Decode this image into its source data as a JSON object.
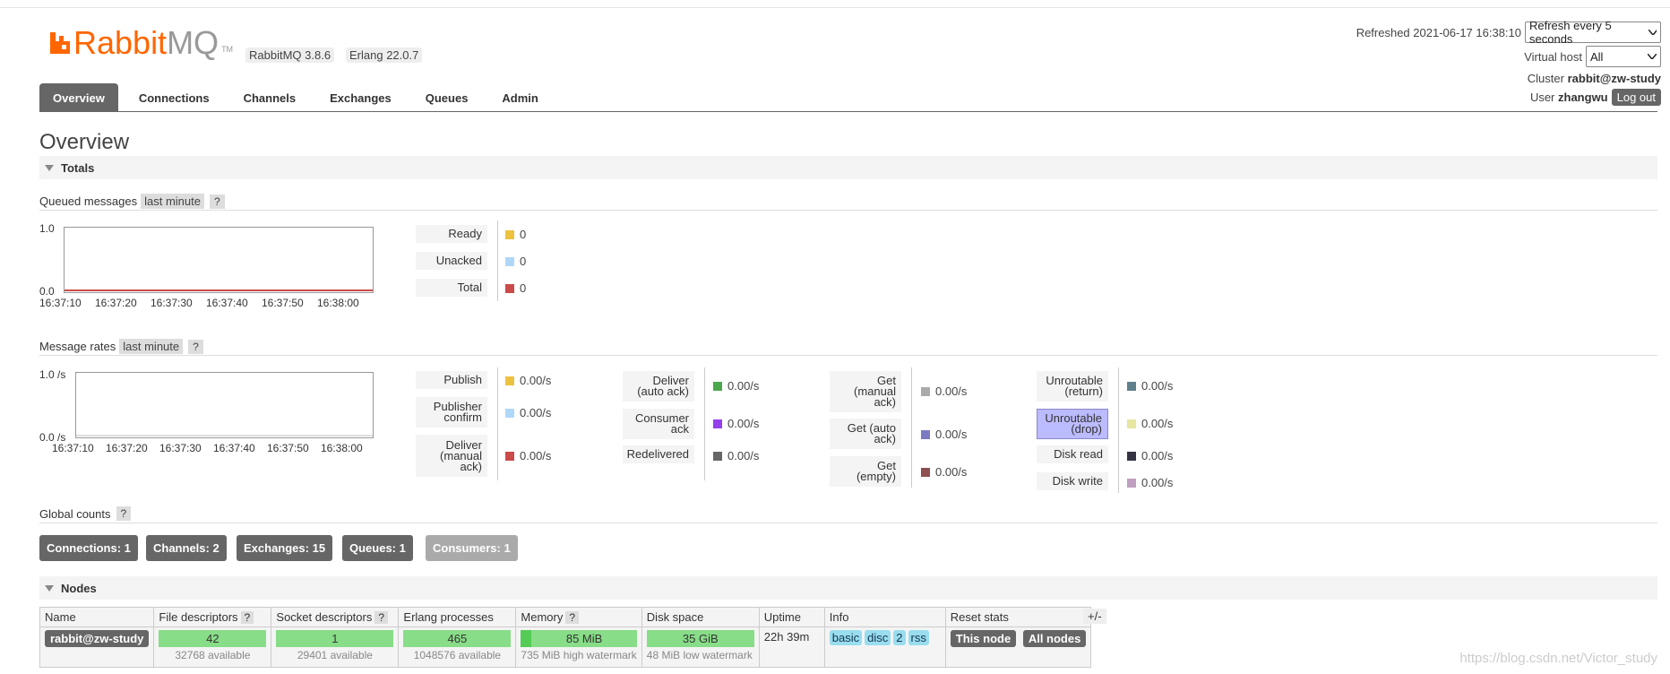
{
  "brand": {
    "rabbit": "Rabbit",
    "mq": "MQ",
    "tm": "TM"
  },
  "versions": {
    "rabbitmq": "RabbitMQ 3.8.6",
    "erlang": "Erlang 22.0.7"
  },
  "header": {
    "refreshed": "Refreshed 2021-06-17 16:38:10",
    "refresh_select": "Refresh every 5 seconds",
    "vhost_label": "Virtual host",
    "vhost_value": "All",
    "cluster_label": "Cluster",
    "cluster_value": "rabbit@zw-study",
    "user_label": "User",
    "user_value": "zhangwu",
    "logout": "Log out"
  },
  "tabs": [
    "Overview",
    "Connections",
    "Channels",
    "Exchanges",
    "Queues",
    "Admin"
  ],
  "page_title": "Overview",
  "totals": {
    "header": "Totals",
    "queued": {
      "label": "Queued messages",
      "range": "last minute",
      "help": "?",
      "y_top": "1.0",
      "y_bottom": "0.0",
      "x_ticks": [
        "16:37:10",
        "16:37:20",
        "16:37:30",
        "16:37:40",
        "16:37:50",
        "16:38:00"
      ],
      "legend": [
        {
          "label": "Ready",
          "value": "0",
          "color": "#edc240"
        },
        {
          "label": "Unacked",
          "value": "0",
          "color": "#afd8f8"
        },
        {
          "label": "Total",
          "value": "0",
          "color": "#cb4b4b"
        }
      ]
    },
    "rates": {
      "label": "Message rates",
      "range": "last minute",
      "help": "?",
      "y_top": "1.0 /s",
      "y_bottom": "0.0 /s",
      "x_ticks": [
        "16:37:10",
        "16:37:20",
        "16:37:30",
        "16:37:40",
        "16:37:50",
        "16:38:00"
      ],
      "col1": [
        {
          "label": "Publish",
          "value": "0.00/s",
          "color": "#edc240"
        },
        {
          "label": "Publisher confirm",
          "value": "0.00/s",
          "color": "#afd8f8"
        },
        {
          "label": "Deliver (manual ack)",
          "value": "0.00/s",
          "color": "#cb4b4b"
        }
      ],
      "col2": [
        {
          "label": "Deliver (auto ack)",
          "value": "0.00/s",
          "color": "#4da74d"
        },
        {
          "label": "Consumer ack",
          "value": "0.00/s",
          "color": "#9440ed"
        },
        {
          "label": "Redelivered",
          "value": "0.00/s",
          "color": "#666666"
        }
      ],
      "col3": [
        {
          "label": "Get (manual ack)",
          "value": "0.00/s",
          "color": "#aaaaaa"
        },
        {
          "label": "Get (auto ack)",
          "value": "0.00/s",
          "color": "#7c79c3"
        },
        {
          "label": "Get (empty)",
          "value": "0.00/s",
          "color": "#8d4f51"
        }
      ],
      "col4": [
        {
          "label": "Unroutable (return)",
          "value": "0.00/s",
          "color": "#5f7f8c"
        },
        {
          "label": "Unroutable (drop)",
          "value": "0.00/s",
          "color": "#e6e6a0"
        },
        {
          "label": "Disk read",
          "value": "0.00/s",
          "color": "#333344"
        },
        {
          "label": "Disk write",
          "value": "0.00/s",
          "color": "#bf9fbf"
        }
      ]
    }
  },
  "global_counts": {
    "label": "Global counts",
    "help": "?",
    "items": [
      "Connections: 1",
      "Channels: 2",
      "Exchanges: 15",
      "Queues: 1",
      "Consumers: 1"
    ]
  },
  "nodes": {
    "header": "Nodes",
    "columns": [
      "Name",
      "File descriptors",
      "Socket descriptors",
      "Erlang processes",
      "Memory",
      "Disk space",
      "Uptime",
      "Info",
      "Reset stats"
    ],
    "help": "?",
    "plus_minus": "+/-",
    "row": {
      "name": "rabbit@zw-study",
      "fd": "42",
      "fd_avail": "32768 available",
      "sd": "1",
      "sd_avail": "29401 available",
      "ep": "465",
      "ep_avail": "1048576 available",
      "mem": "85 MiB",
      "mem_note": "735 MiB high watermark",
      "disk": "35 GiB",
      "disk_note": "48 MiB low watermark",
      "uptime": "22h 39m",
      "info": [
        "basic",
        "disc",
        "2",
        "rss"
      ],
      "reset_this": "This node",
      "reset_all": "All nodes"
    }
  },
  "watermark": "https://blog.csdn.net/Victor_study"
}
